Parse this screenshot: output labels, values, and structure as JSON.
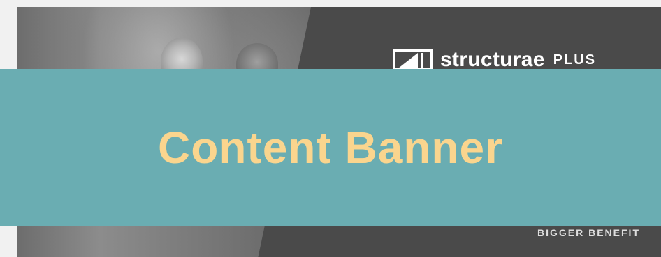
{
  "banner": {
    "title": "Content Banner",
    "background_color": "#6aadb2",
    "title_color": "#fad58e"
  },
  "hero": {
    "brand": {
      "wordmark": "structurae",
      "suffix": "PLUS",
      "logo_icon": "structure-logo-icon"
    },
    "tagline": "BIGGER BENEFIT",
    "panel_color": "#4a4a4a"
  }
}
